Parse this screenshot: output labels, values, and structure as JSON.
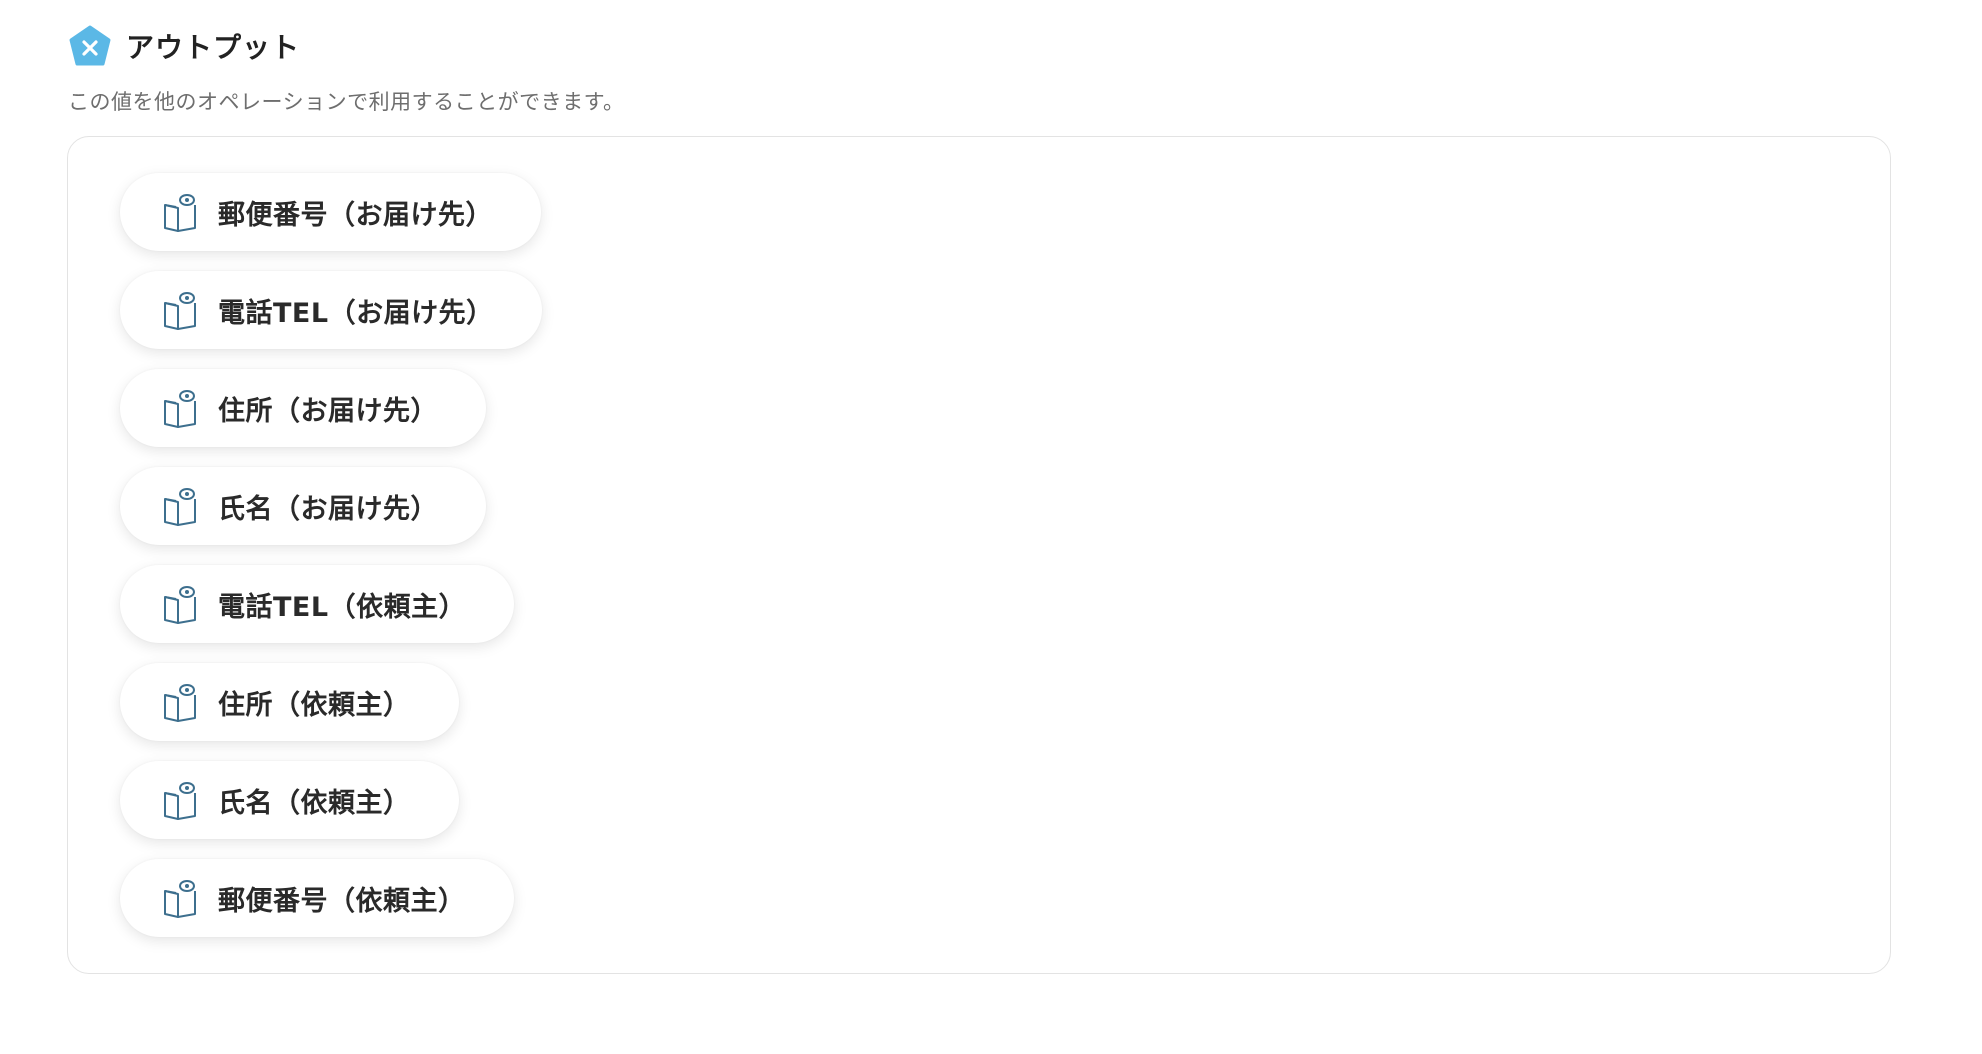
{
  "header": {
    "title": "アウトプット",
    "logo_icon": "x-pentagon-icon",
    "logo_color": "#5bb8e6"
  },
  "description": "この値を他のオペレーションで利用することができます。",
  "outputs": {
    "icon": "book-eye-icon",
    "icon_color": "#3d6f8e",
    "items": [
      {
        "label": "郵便番号（お届け先）"
      },
      {
        "label": "電話TEL（お届け先）"
      },
      {
        "label": "住所（お届け先）"
      },
      {
        "label": "氏名（お届け先）"
      },
      {
        "label": "電話TEL（依頼主）"
      },
      {
        "label": "住所（依頼主）"
      },
      {
        "label": "氏名（依頼主）"
      },
      {
        "label": "郵便番号（依頼主）"
      }
    ]
  }
}
